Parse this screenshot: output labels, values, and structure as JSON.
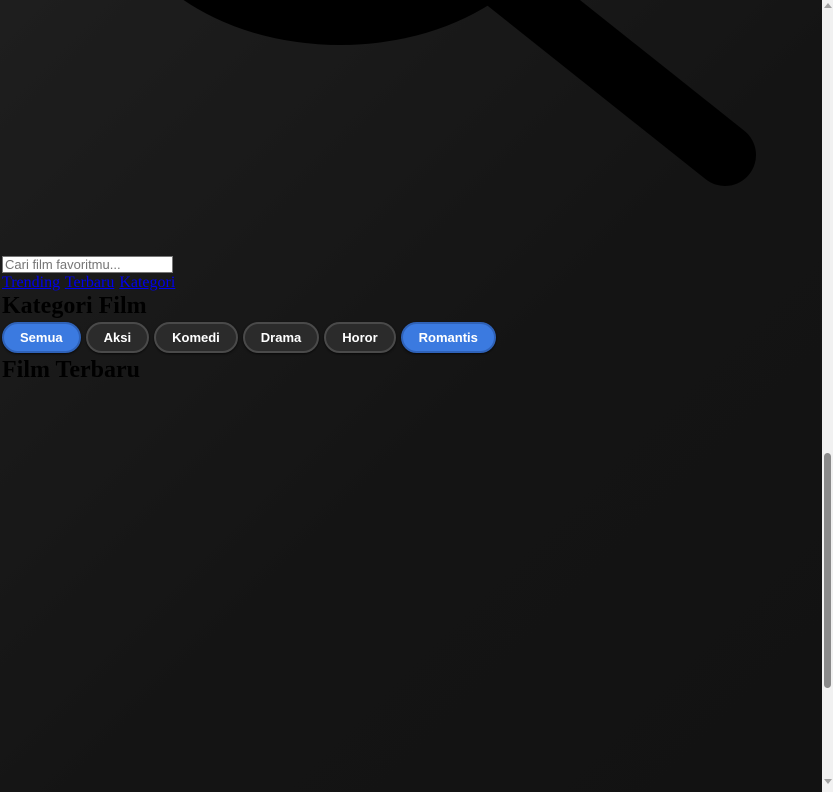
{
  "hero": {
    "icon": "search-icon"
  },
  "search": {
    "placeholder": "Cari film favoritmu...",
    "value": ""
  },
  "nav": {
    "links": [
      "Trending",
      "Terbaru",
      "Kategori"
    ]
  },
  "categories": {
    "title": "Kategori Film",
    "chips": [
      "Semua",
      "Aksi",
      "Komedi",
      "Drama",
      "Horor",
      "Romantis"
    ],
    "active": [
      "Semua",
      "Romantis"
    ]
  },
  "latest": {
    "title": "Film Terbaru"
  },
  "colors": {
    "background": "#161616",
    "chip": "#2b2b2b",
    "chip_active": "#3b7ae0",
    "link": "#0000ee"
  }
}
